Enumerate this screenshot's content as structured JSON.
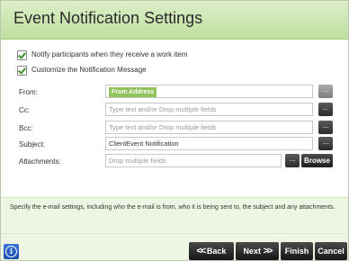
{
  "dialog": {
    "title": "Event Notification Settings"
  },
  "options": {
    "notify_label": "Notify participants when they receive a work item",
    "notify_checked": true,
    "customize_label": "Customize the Notification Message",
    "customize_checked": true
  },
  "form": {
    "from_label": "From:",
    "from_token": "From Address",
    "cc_label": "Cc:",
    "cc_placeholder": "Type text and/or Drop multiple fields",
    "bcc_label": "Bcc:",
    "bcc_placeholder": "Type text and/or Drop multiple fields",
    "subject_label": "Subject:",
    "subject_value": "ClientEvent Notification",
    "attachments_label": "Attachments:",
    "attachments_placeholder": "Drop multiple fields",
    "ellipsis": "...",
    "browse_label": "Browse"
  },
  "help": {
    "text": "Specify the e-mail settings, including who the e-mail is from, who it is being sent to, the subject and any attachments."
  },
  "footer": {
    "info_icon": "info-icon",
    "back_label": "Back",
    "next_label": "Next",
    "finish_label": "Finish",
    "cancel_label": "Cancel"
  },
  "colors": {
    "header_green": "#bedea0",
    "token_green": "#8fc35b",
    "help_bg": "#eef5e3",
    "button_dark": "#1f1f1f",
    "info_blue": "#2b5fc4"
  }
}
